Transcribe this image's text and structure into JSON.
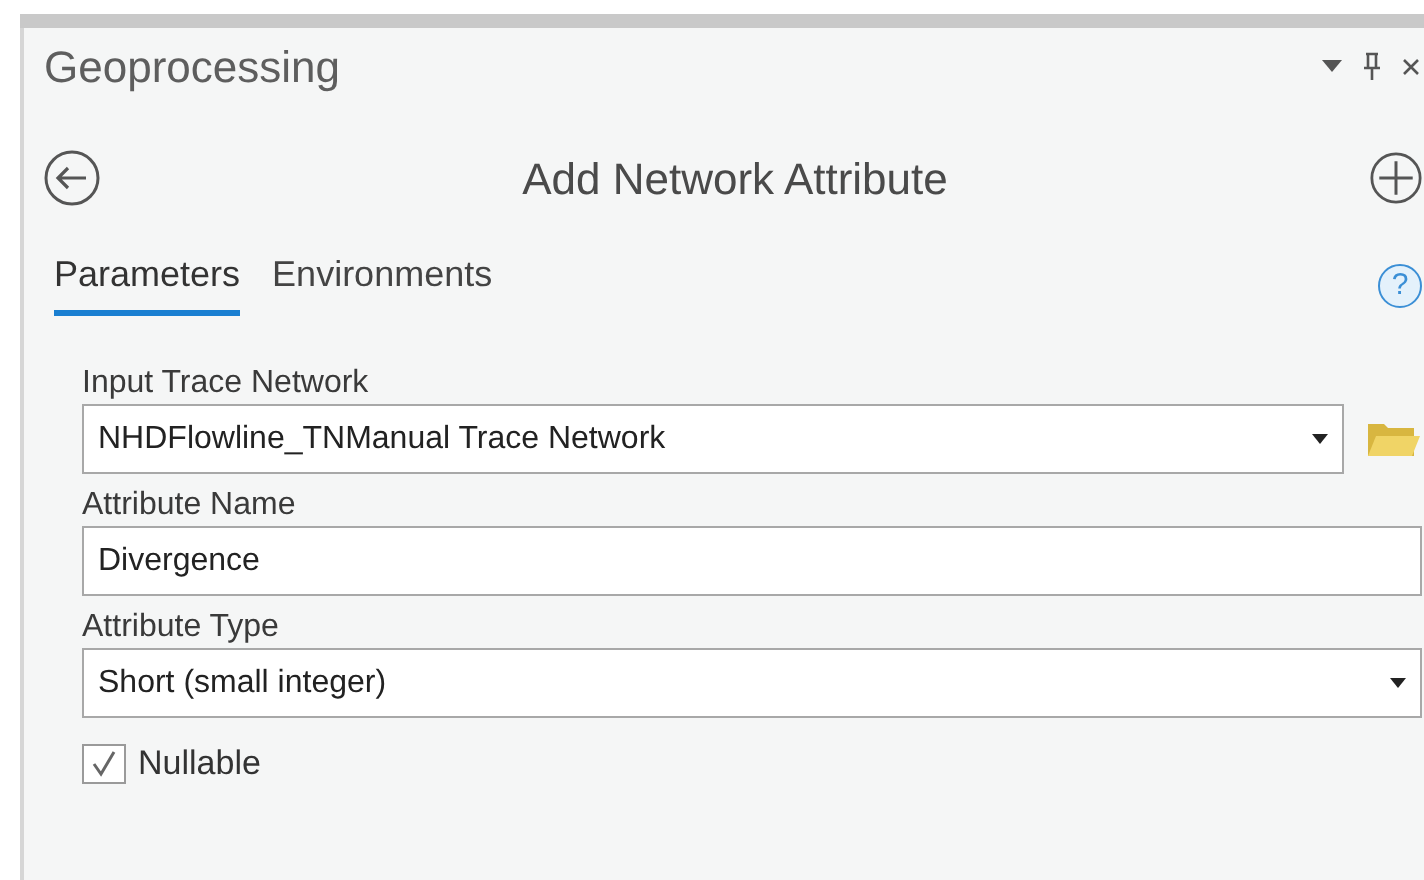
{
  "panel": {
    "title": "Geoprocessing"
  },
  "tool": {
    "title": "Add Network Attribute"
  },
  "help": {
    "label": "?"
  },
  "tabs": [
    {
      "label": "Parameters",
      "selected": true
    },
    {
      "label": "Environments",
      "selected": false
    }
  ],
  "parameters": [
    {
      "kind": "dropdown",
      "label": "Input Trace Network",
      "value": "NHDFlowline_TNManual Trace Network",
      "browse": true
    },
    {
      "kind": "text",
      "label": "Attribute Name",
      "value": "Divergence"
    },
    {
      "kind": "dropdown",
      "label": "Attribute Type",
      "value": "Short (small integer)",
      "browse": false
    },
    {
      "kind": "checkbox",
      "label": "Nullable",
      "checked": true
    }
  ]
}
